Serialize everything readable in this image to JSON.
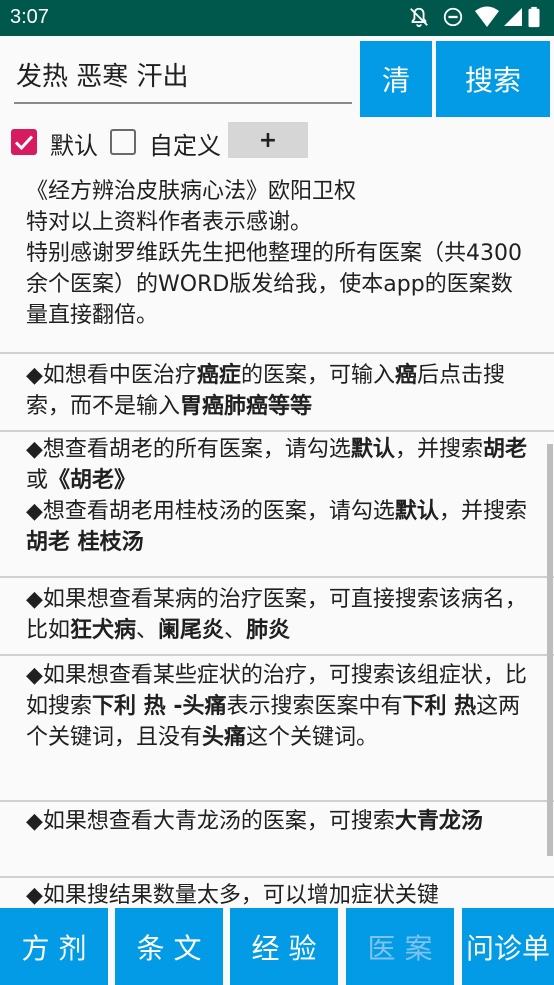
{
  "status_bar": {
    "time": "3:07",
    "icons": [
      "notifications-off-icon",
      "do-not-disturb-icon",
      "wifi-icon",
      "signal-icon",
      "battery-icon"
    ]
  },
  "search": {
    "query": "发热 恶寒 汗出",
    "clear_label": "清",
    "search_label": "搜索"
  },
  "options": {
    "default_label": "默认",
    "default_checked": true,
    "custom_label": "自定义",
    "custom_checked": false,
    "add_label": "+"
  },
  "content": {
    "credits": {
      "line1": "《经方辨治皮肤病心法》欧阳卫权",
      "line2": "特对以上资料作者表示感谢。",
      "line3": "特别感谢罗维跃先生把他整理的所有医案（共4300余个医案）的WORD版发给我，使本app的医案数量直接翻倍。"
    },
    "tip1": {
      "t1": "◆如想看中医治疗",
      "b1": "癌症",
      "t2": "的医案，可输入",
      "b2": "癌",
      "t3": "后点击搜索，而不是输入",
      "b3": "胃癌肺癌等等"
    },
    "tip2": {
      "t1": "◆想查看胡老的所有医案，请勾选",
      "b1": "默认",
      "t2": "，并搜索",
      "b2": "胡老",
      "t3": "或",
      "b3": "《胡老》"
    },
    "tip3": {
      "t1": "◆想查看胡老用桂枝汤的医案，请勾选",
      "b1": "默认",
      "t2": "，并搜索",
      "b2": "胡老 桂枝汤"
    },
    "tip4": {
      "t1": "◆如果想查看某病的治疗医案，可直接搜索该病名，比如",
      "b1": "狂犬病",
      "t2": "、",
      "b2": "阑尾炎",
      "t3": "、",
      "b3": "肺炎"
    },
    "tip5": {
      "t1": "◆如果想查看某些症状的治疗，可搜索该组症状，比如搜索",
      "b1": "下利 热 -头痛",
      "t2": "表示搜索医案中有",
      "b2": "下利 热",
      "t3": "这两个关键词，且没有",
      "b3": "头痛",
      "t4": "这个关键词。"
    },
    "tip6": {
      "t1": "◆如果想查看大青龙汤的医案，可搜索",
      "b1": "大青龙汤"
    },
    "tip7": {
      "t1": "◆如果搜结果数量太多，可以增加症状关键"
    }
  },
  "nav": {
    "tabs": [
      {
        "label": "方 剂"
      },
      {
        "label": "条 文"
      },
      {
        "label": "经 验"
      },
      {
        "label": "医 案"
      },
      {
        "label": "问诊单"
      }
    ],
    "active_index": 3
  },
  "colors": {
    "status_bar": "#00574b",
    "accent_blue": "#039be5",
    "checkbox_checked": "#d81b60"
  }
}
